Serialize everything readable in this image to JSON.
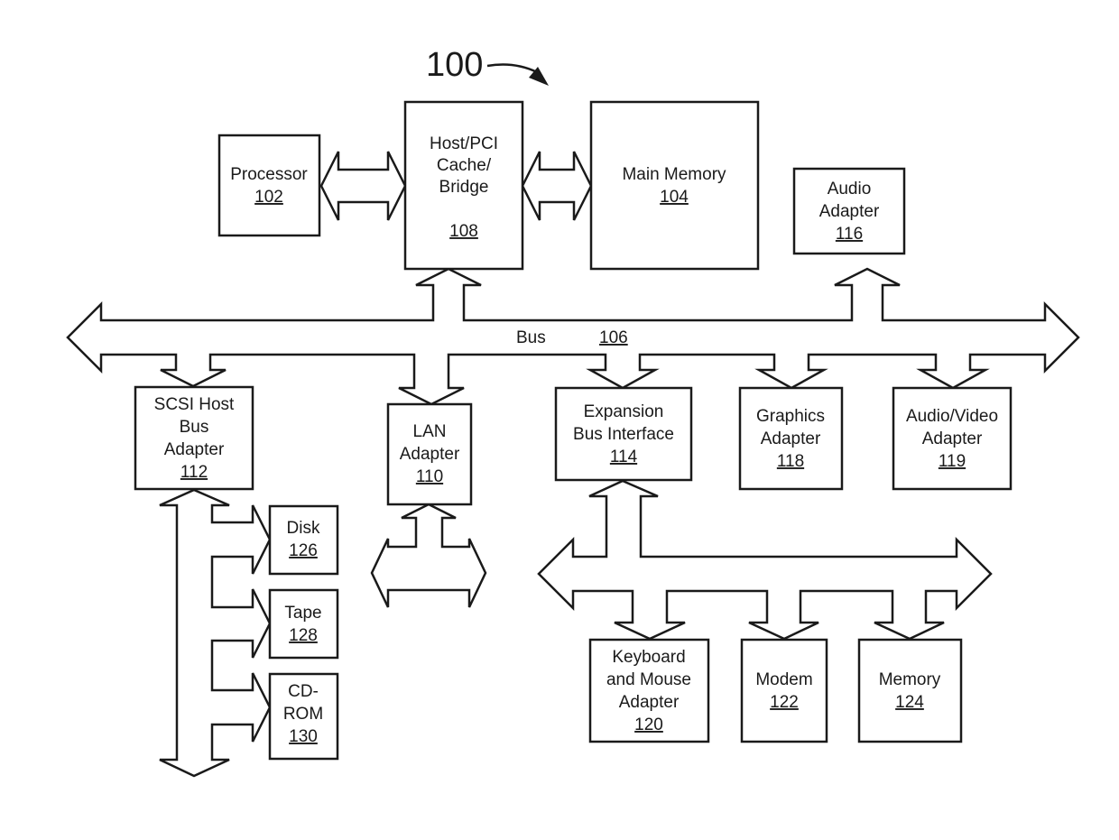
{
  "figure": {
    "number": "100"
  },
  "bus": {
    "label": "Bus",
    "ref": "106"
  },
  "components": {
    "processor": {
      "lines": [
        "Processor"
      ],
      "ref": "102"
    },
    "host_bridge": {
      "lines": [
        "Host/PCI",
        "Cache/",
        "Bridge"
      ],
      "ref": "108"
    },
    "main_memory": {
      "lines": [
        "Main Memory"
      ],
      "ref": "104"
    },
    "audio_adapter": {
      "lines": [
        "Audio",
        "Adapter"
      ],
      "ref": "116"
    },
    "scsi": {
      "lines": [
        "SCSI Host",
        "Bus",
        "Adapter"
      ],
      "ref": "112"
    },
    "lan": {
      "lines": [
        "LAN",
        "Adapter"
      ],
      "ref": "110"
    },
    "expansion": {
      "lines": [
        "Expansion",
        "Bus Interface"
      ],
      "ref": "114"
    },
    "graphics": {
      "lines": [
        "Graphics",
        "Adapter"
      ],
      "ref": "118"
    },
    "av_adapter": {
      "lines": [
        "Audio/Video",
        "Adapter"
      ],
      "ref": "119"
    },
    "disk": {
      "lines": [
        "Disk"
      ],
      "ref": "126"
    },
    "tape": {
      "lines": [
        "Tape"
      ],
      "ref": "128"
    },
    "cdrom": {
      "lines": [
        "CD-",
        "ROM"
      ],
      "ref": "130"
    },
    "keyboard": {
      "lines": [
        "Keyboard",
        "and Mouse",
        "Adapter"
      ],
      "ref": "120"
    },
    "modem": {
      "lines": [
        "Modem"
      ],
      "ref": "122"
    },
    "memory": {
      "lines": [
        "Memory"
      ],
      "ref": "124"
    }
  }
}
